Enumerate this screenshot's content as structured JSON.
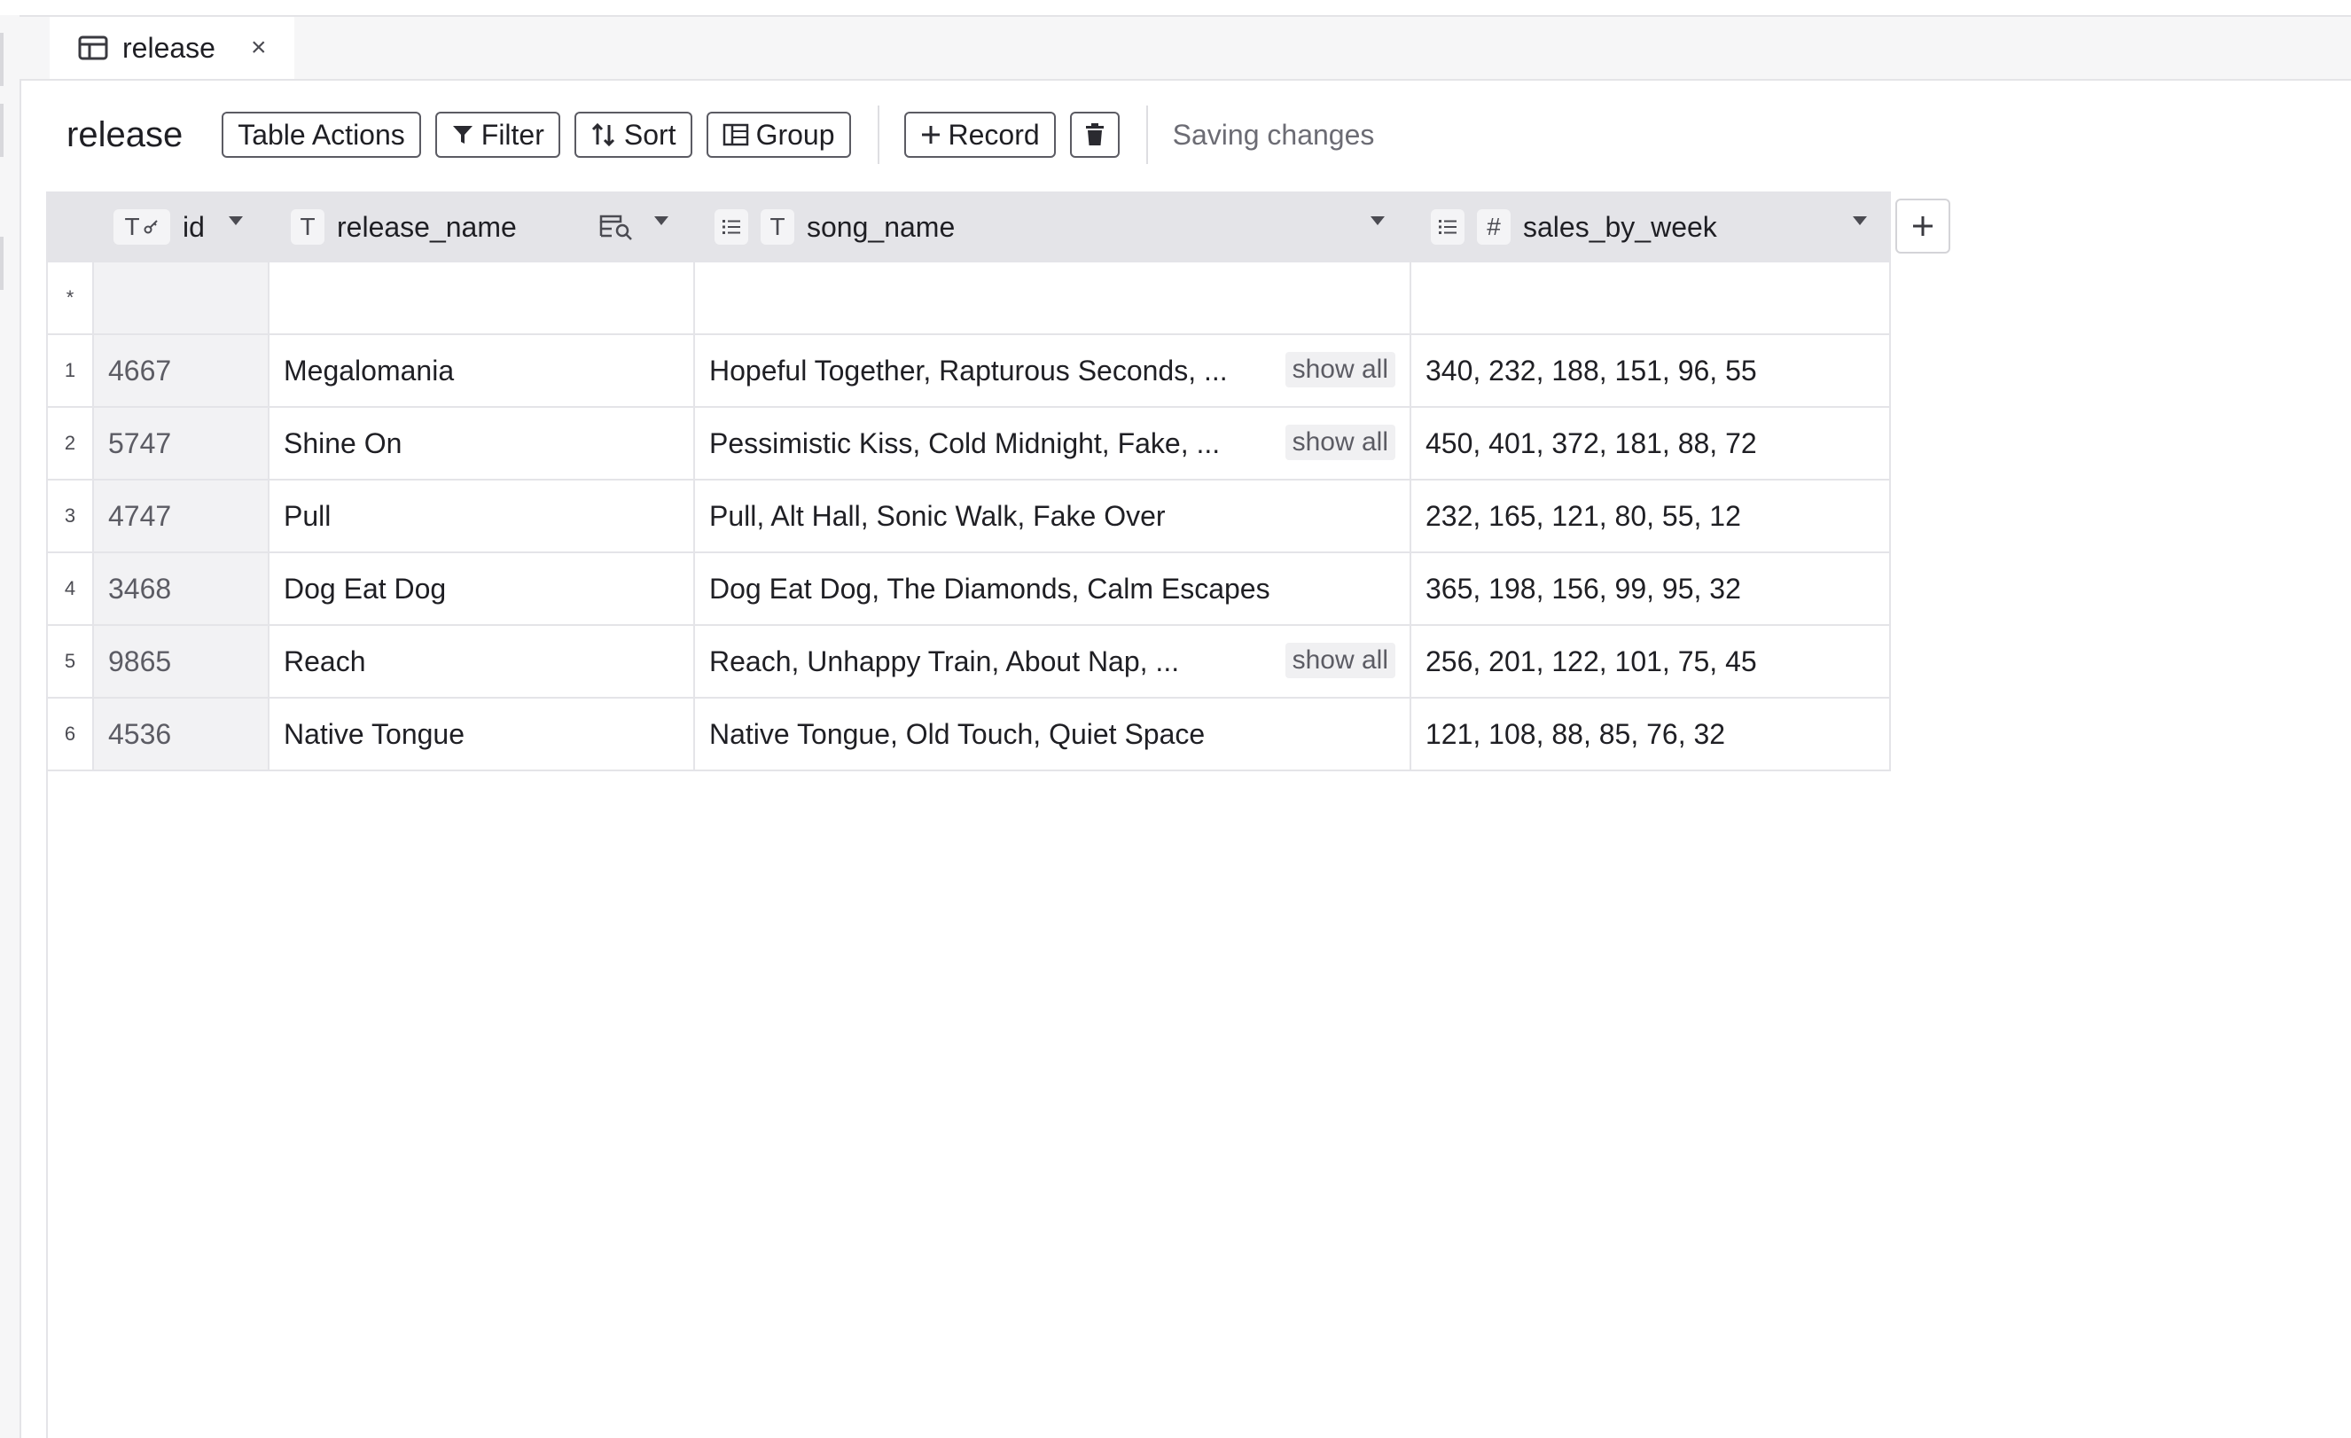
{
  "tab": {
    "label": "release",
    "close": "×"
  },
  "toolbar": {
    "title": "release",
    "table_actions": "Table Actions",
    "filter": "Filter",
    "sort": "Sort",
    "group": "Group",
    "record": "Record",
    "status": "Saving changes"
  },
  "columns": {
    "id": {
      "type_chip": "T",
      "label": "id"
    },
    "release_name": {
      "type_chip": "T",
      "label": "release_name"
    },
    "song_name": {
      "type_chip": "T",
      "label": "song_name"
    },
    "sales_by_week": {
      "type_chip": "#",
      "label": "sales_by_week"
    }
  },
  "new_row_marker": "*",
  "show_all_label": "show all",
  "rows": [
    {
      "num": "1",
      "id": "4667",
      "release_name": "Megalomania",
      "song_name": "Hopeful Together, Rapturous Seconds, ...",
      "sales_by_week": "340, 232, 188, 151, 96, 55"
    },
    {
      "num": "2",
      "id": "5747",
      "release_name": "Shine On",
      "song_name": "Pessimistic Kiss, Cold Midnight, Fake, ...",
      "sales_by_week": "450, 401, 372, 181, 88, 72"
    },
    {
      "num": "3",
      "id": "4747",
      "release_name": "Pull",
      "song_name": "Pull, Alt Hall, Sonic Walk, Fake Over",
      "sales_by_week": "232, 165, 121, 80, 55, 12"
    },
    {
      "num": "4",
      "id": "3468",
      "release_name": "Dog Eat Dog",
      "song_name": "Dog Eat Dog, The Diamonds, Calm Escapes",
      "sales_by_week": "365, 198, 156, 99, 95, 32"
    },
    {
      "num": "5",
      "id": "9865",
      "release_name": "Reach",
      "song_name": "Reach, Unhappy Train, About Nap, ...",
      "sales_by_week": "256, 201, 122, 101, 75, 45"
    },
    {
      "num": "6",
      "id": "4536",
      "release_name": "Native Tongue",
      "song_name": "Native Tongue, Old Touch, Quiet Space",
      "sales_by_week": "121, 108, 88, 85, 76, 32"
    }
  ]
}
